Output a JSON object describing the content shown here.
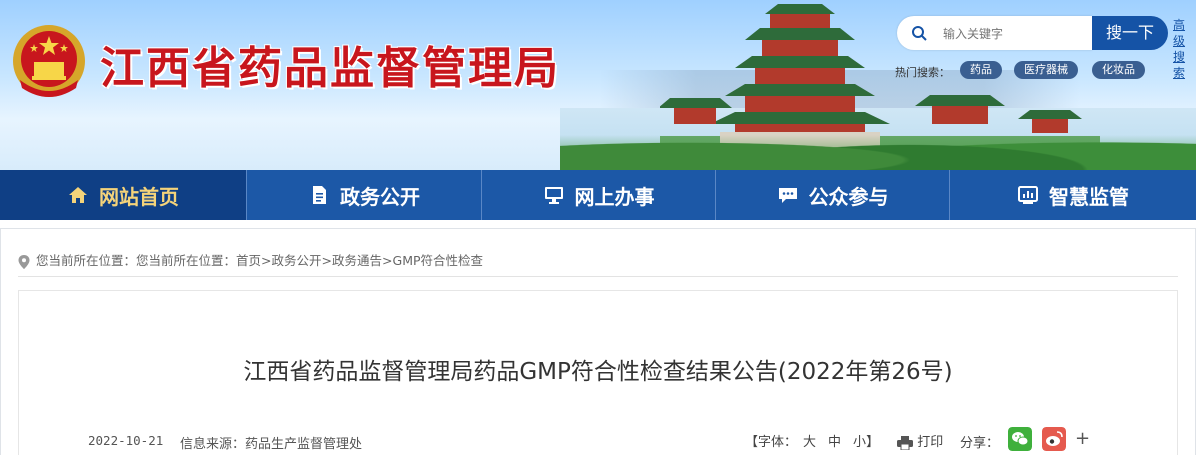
{
  "header": {
    "site_title": "江西省药品监督管理局",
    "search": {
      "placeholder": "输入关键字",
      "button_label": "搜一下",
      "advanced_label": "高级搜索"
    },
    "hot_search": {
      "label": "热门搜索：",
      "tags": [
        "药品",
        "医疗器械",
        "化妆品"
      ]
    }
  },
  "nav": {
    "items": [
      {
        "label": "网站首页",
        "icon": "home-icon"
      },
      {
        "label": "政务公开",
        "icon": "document-icon"
      },
      {
        "label": "网上办事",
        "icon": "monitor-icon"
      },
      {
        "label": "公众参与",
        "icon": "chat-icon"
      },
      {
        "label": "智慧监管",
        "icon": "chart-icon"
      }
    ]
  },
  "breadcrumb": {
    "prefix": "您当前所在位置：您当前所在位置：",
    "items": [
      "首页",
      "政务公开",
      "政务通告",
      "GMP符合性检查"
    ],
    "separator": ">"
  },
  "article": {
    "title": "江西省药品监督管理局药品GMP符合性检查结果公告(2022年第26号)",
    "date": "2022-10-21",
    "source": "信息来源：药品生产监督管理处",
    "font_size": {
      "label": "【字体：",
      "large": "大",
      "medium": "中",
      "small": "小",
      "close": "】"
    },
    "print_label": "打印",
    "share_label": "分享：",
    "share_more": "+"
  },
  "colors": {
    "brand_red": "#c8161d",
    "nav_blue": "#1c58a7",
    "nav_active": "#0f3f85",
    "accent_gold": "#f4d37a"
  }
}
